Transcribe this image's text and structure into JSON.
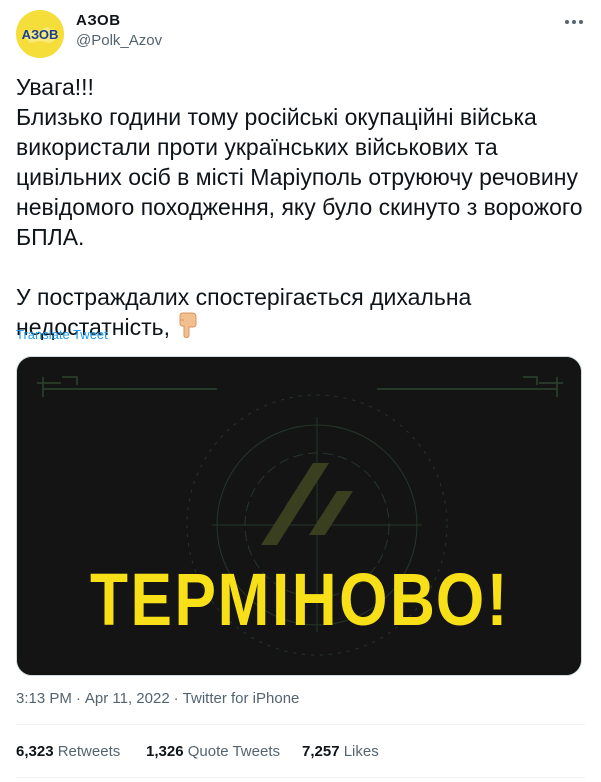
{
  "author": {
    "name": "АЗОВ",
    "handle": "@Polk_Azov",
    "avatar_text": "АЗОВ"
  },
  "more_icon": "ellipsis-icon",
  "tweet": {
    "paragraph1": "Увага!!!",
    "paragraph2": "Близько години тому російські окупаційні війська використали проти українських військових та цивільних осіб в місті Маріуполь отруюючу речовину невідомого походження, яку було скинуто з ворожого БПЛА.",
    "paragraph3": "У постраждалих спостерігається дихальна недостатність,",
    "emoji": "backhand-index-pointing-down",
    "translate_label": "Translate Tweet"
  },
  "media": {
    "headline": "ТЕРМІНОВО!",
    "headline_color": "#f7e017",
    "background_color": "#141414"
  },
  "meta": {
    "time": "3:13 PM",
    "date": "Apr 11, 2022",
    "source": "Twitter for iPhone"
  },
  "stats": {
    "retweets_count": "6,323",
    "retweets_label": "Retweets",
    "quotes_count": "1,326",
    "quotes_label": "Quote Tweets",
    "likes_count": "7,257",
    "likes_label": "Likes"
  },
  "colors": {
    "link": "#1d9bf0",
    "secondary_text": "#536471"
  }
}
